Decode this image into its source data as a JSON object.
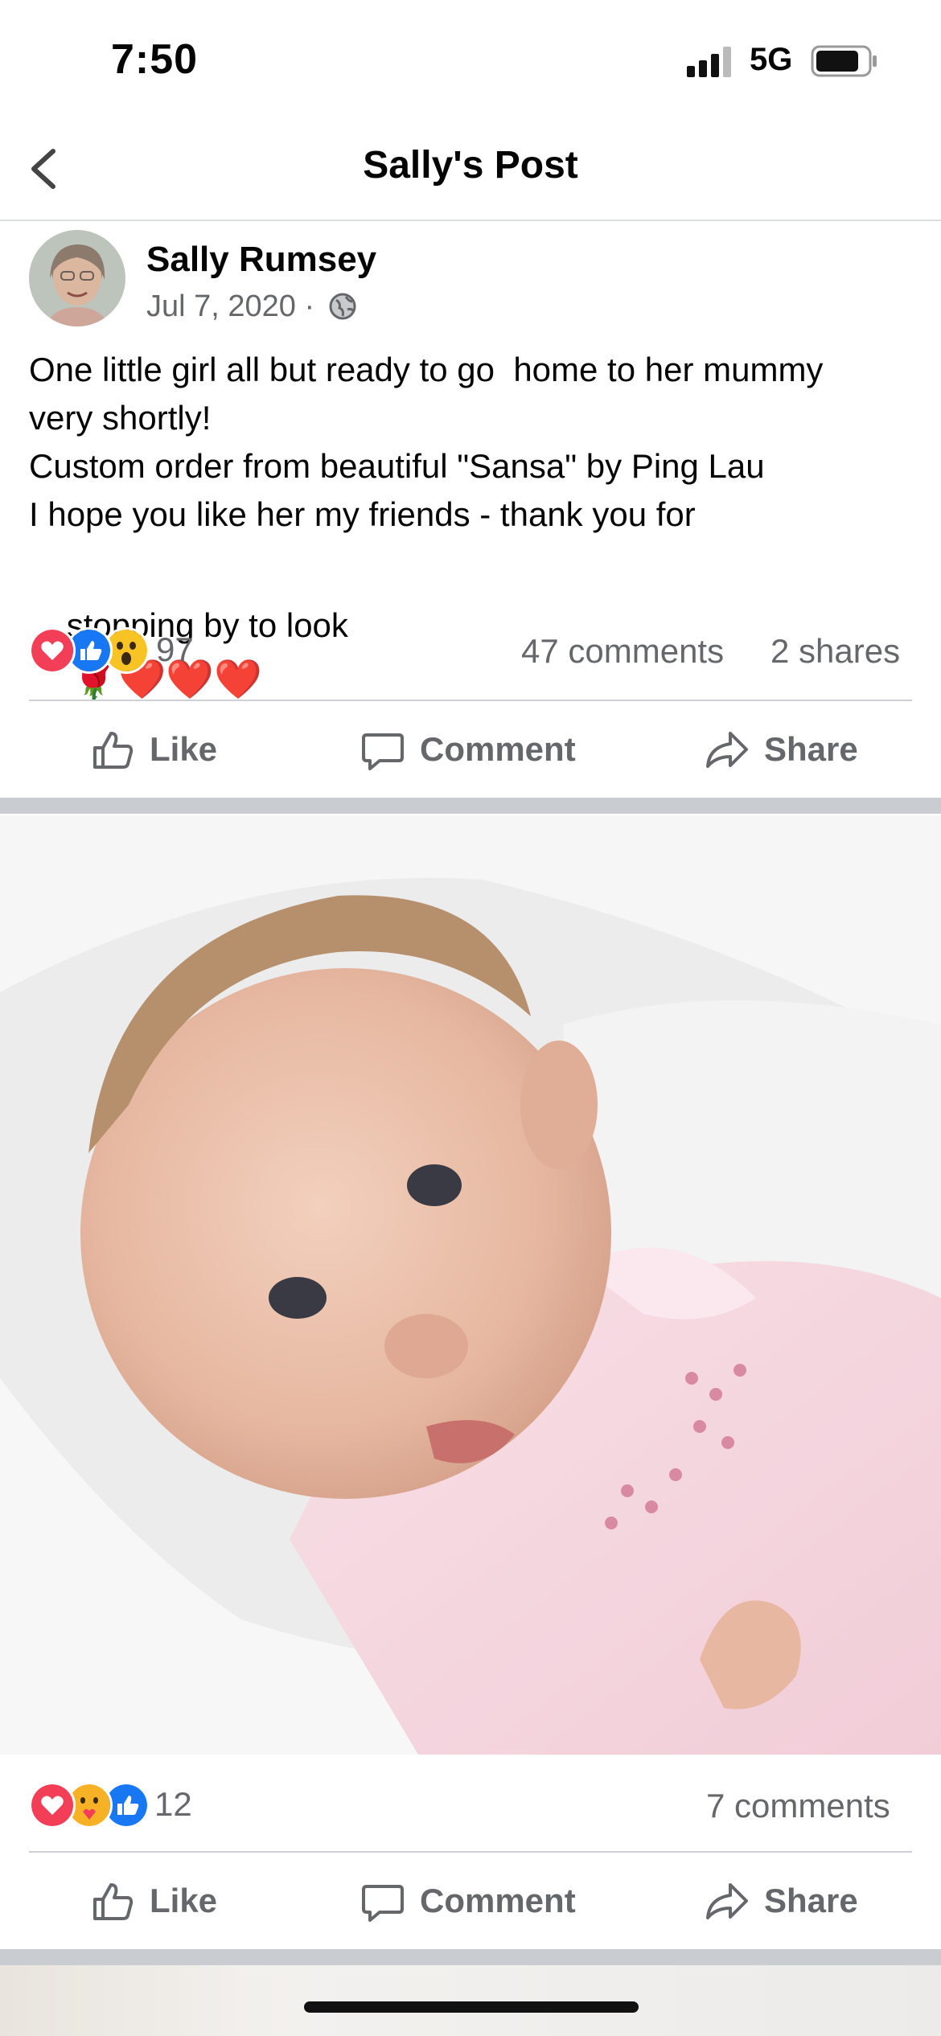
{
  "status": {
    "time": "7:50",
    "network": "5G"
  },
  "nav": {
    "title": "Sally's Post"
  },
  "post": {
    "author": "Sally Rumsey",
    "date": "Jul 7, 2020",
    "separator": "·",
    "text_lines": [
      "One little girl all but ready to go  home to her mummy",
      "very shortly!",
      "Custom order from beautiful \"Sansa\" by Ping Lau",
      "I hope you like her my friends - thank you for",
      "stopping by to look"
    ],
    "emojis": "🌹❤️❤️❤️",
    "reaction_count": "97",
    "comments": "47 comments",
    "shares": "2 shares"
  },
  "actions": {
    "like": "Like",
    "comment": "Comment",
    "share": "Share"
  },
  "photo_post": {
    "reaction_count": "12",
    "comments": "7 comments"
  },
  "colors": {
    "like_blue": "#1877f2",
    "love_red": "#f33e58",
    "care_yellow": "#f7b125",
    "muted": "#65676b"
  }
}
